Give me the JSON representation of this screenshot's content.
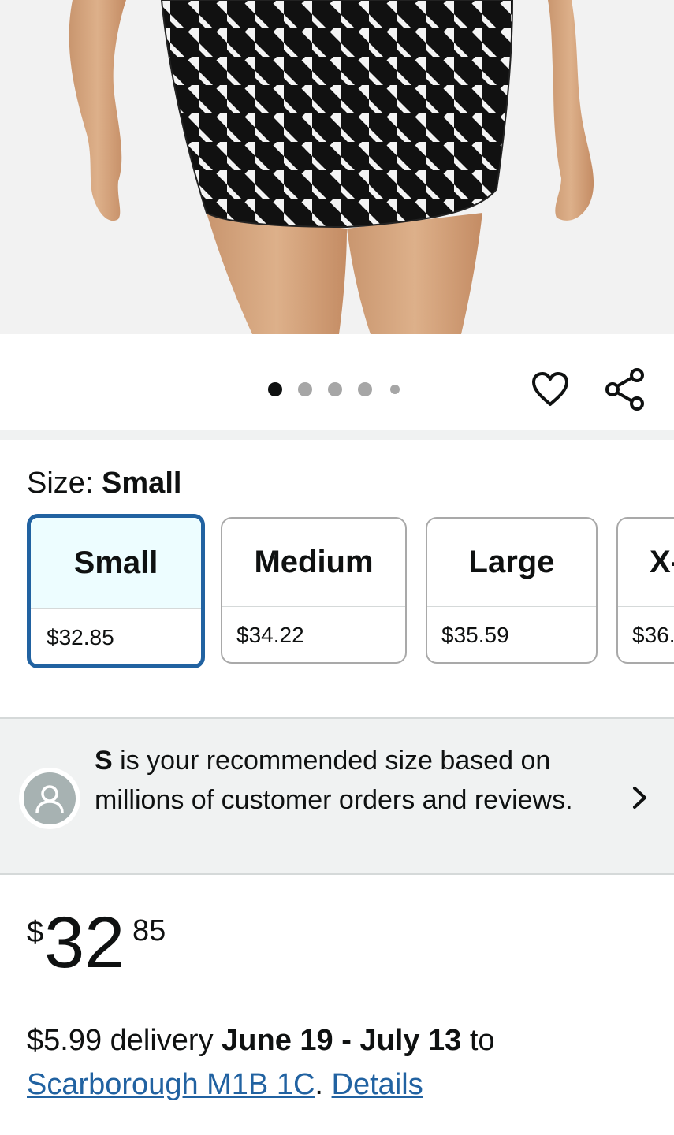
{
  "product_image": {
    "alt": "",
    "carousel": {
      "count": 5,
      "active_index": 0
    }
  },
  "actions": {
    "favorite_icon": "heart-outline-icon",
    "share_icon": "share-icon"
  },
  "size": {
    "label_prefix": "Size:",
    "selected_name": "Small",
    "options": [
      {
        "name": "Small",
        "price": "$32.85",
        "selected": true
      },
      {
        "name": "Medium",
        "price": "$34.22",
        "selected": false
      },
      {
        "name": "Large",
        "price": "$35.59",
        "selected": false
      },
      {
        "name": "X-",
        "price": "$36.",
        "selected": false
      }
    ]
  },
  "recommendation": {
    "size_letter": "S",
    "text": "is your recommended size based on millions of customer orders and reviews."
  },
  "price": {
    "symbol": "$",
    "whole": "32",
    "fraction": "85"
  },
  "delivery": {
    "prefix": "$5.99 delivery",
    "dates": "June 19 - July 13",
    "to": "to",
    "location_link": "Scarborough M1B 1C",
    "period": ".",
    "details_link": "Details"
  },
  "colors": {
    "accent": "#2162a1",
    "selected_bg": "#edfdff",
    "banner_bg": "#f0f2f2"
  }
}
